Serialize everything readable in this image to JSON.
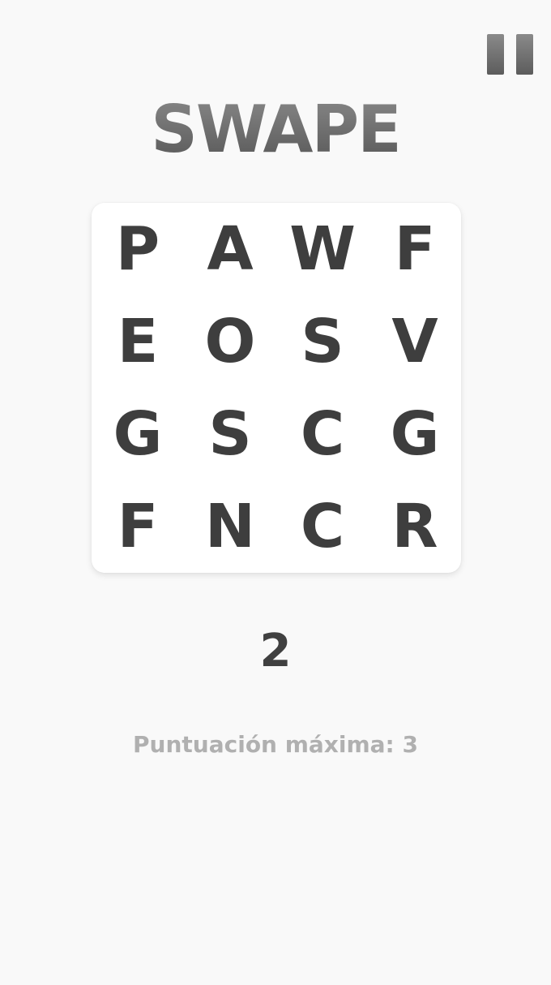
{
  "header": {
    "title": "SWAPE",
    "pause_icon": "pause-icon"
  },
  "board": {
    "rows": [
      [
        "P",
        "A",
        "W",
        "F"
      ],
      [
        "E",
        "O",
        "S",
        "V"
      ],
      [
        "G",
        "S",
        "C",
        "G"
      ],
      [
        "F",
        "N",
        "C",
        "R"
      ]
    ]
  },
  "score": {
    "current": "2",
    "best_label": "Puntuación máxima: 3"
  },
  "colors": {
    "background": "#f9f9f9",
    "board": "#ffffff",
    "tile_letter": "#3e3e3e",
    "title": "#6a6a6a",
    "best_score_text": "#b0b0b0"
  }
}
